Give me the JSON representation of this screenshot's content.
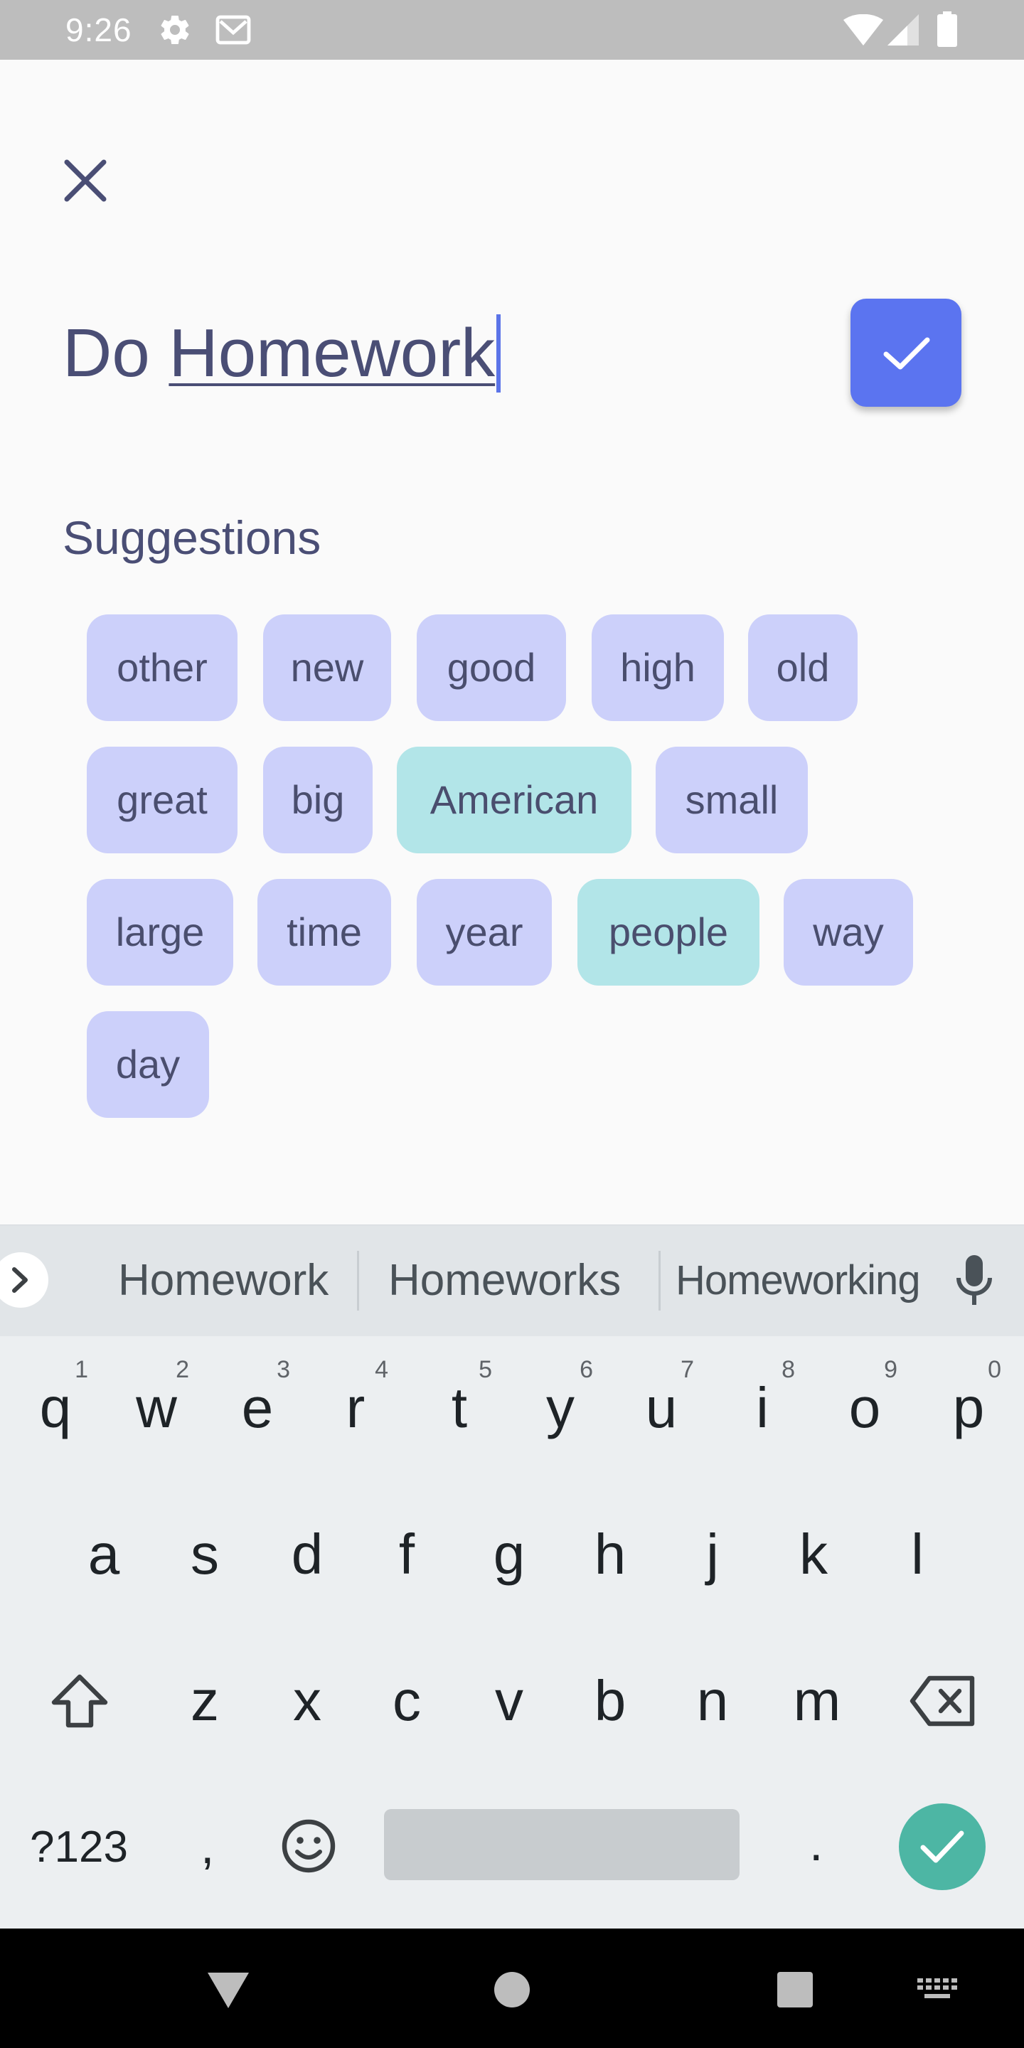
{
  "status_bar": {
    "time": "9:26",
    "icons": [
      "gear-icon",
      "mail-icon",
      "wifi-icon",
      "signal-icon",
      "battery-icon"
    ]
  },
  "editor": {
    "title_prefix": "Do ",
    "title_underlined": "Homework",
    "close_icon": "close-icon",
    "confirm_icon": "check-icon",
    "accent": "#5B74F0"
  },
  "suggestions": {
    "heading": "Suggestions",
    "rows": [
      [
        "other",
        "new",
        "good",
        "high",
        "old"
      ],
      [
        "great",
        "big",
        "American",
        "small"
      ],
      [
        "large",
        "time",
        "year",
        "people",
        "way"
      ],
      [
        "day"
      ]
    ],
    "highlighted": [
      "American",
      "people"
    ],
    "chip_color": "#CCD0FA",
    "highlight_color": "#B2E5E8"
  },
  "keyboard": {
    "suggestions": [
      "Homework",
      "Homeworks",
      "Homeworking"
    ],
    "row1": [
      "q",
      "w",
      "e",
      "r",
      "t",
      "y",
      "u",
      "i",
      "o",
      "p"
    ],
    "row1_hints": [
      "1",
      "2",
      "3",
      "4",
      "5",
      "6",
      "7",
      "8",
      "9",
      "0"
    ],
    "row2": [
      "a",
      "s",
      "d",
      "f",
      "g",
      "h",
      "j",
      "k",
      "l"
    ],
    "row3": [
      "z",
      "x",
      "c",
      "v",
      "b",
      "n",
      "m"
    ],
    "symbols_label": "?123",
    "comma": ",",
    "period": ".",
    "enter_color": "#4DB6A4"
  }
}
